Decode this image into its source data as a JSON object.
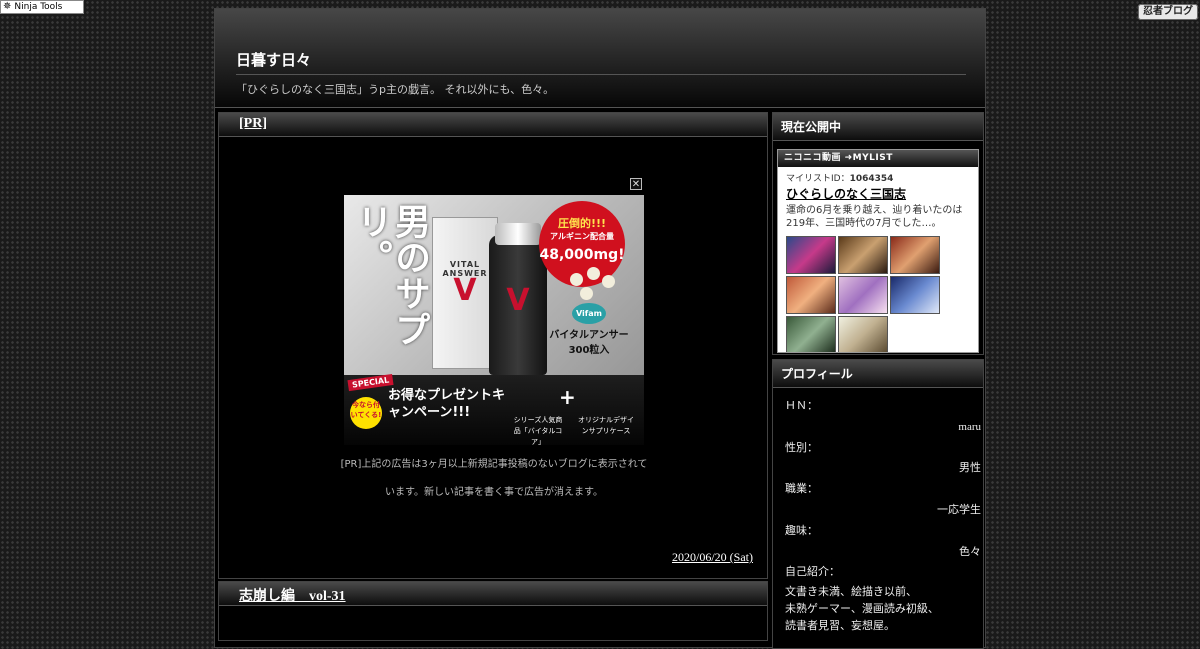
{
  "toolbar": {
    "ninja_tools_label": "Ninja Tools",
    "shinobi_logo": "忍者ブログ"
  },
  "site": {
    "title": "日暮す日々",
    "description": "「ひぐらしのなく三国志」うp主の戯言。 それ以外にも、色々。"
  },
  "posts": [
    {
      "title": "[PR]",
      "ad": {
        "headline": "男のサプリ。",
        "brand": "VITAL ANSWER",
        "badge_line1": "圧倒的!!!",
        "badge_line2": "アルギニン配合量",
        "badge_line3": "48,000mg!",
        "product_logo": "Vifam",
        "product_name": "バイタルアンサー",
        "product_count": "300粒入",
        "special": "SPECIAL",
        "round_badge": "今なら付いてくる!",
        "campaign": "お得なプレゼントキャンペーン!!!",
        "plus": "+",
        "sub1": "シリーズ人気商品「バイタルコア」",
        "sub2": "オリジナルデザインサプリケース",
        "close_symbol": "✕",
        "info_symbol": "i"
      },
      "notice": "[PR]上記の広告は3ヶ月以上新規記事投稿のないブログに表示されています。新しい記事を書く事で広告が消えます。",
      "date": "2020/06/20 (Sat)"
    },
    {
      "title": "志崩し編　vol-31"
    }
  ],
  "sidebar": {
    "now_public": {
      "title": "現在公開中",
      "widget": {
        "bar_label": "ニコニコ動画 ➜MYLIST",
        "mylist_prefix": "マイリストID：",
        "mylist_id": "1064354",
        "name": "ひぐらしのなく三国志",
        "desc": "運命の6月を乗り越え、辿り着いたのは219年、三国時代の7月でした…。"
      }
    },
    "profile": {
      "title": "プロフィール",
      "hn_label": "ＨＮ：",
      "hn_value": "maru",
      "gender_label": "性別：",
      "gender_value": "男性",
      "job_label": "職業：",
      "job_value": "一応学生",
      "hobby_label": "趣味：",
      "hobby_value": "色々",
      "intro_label": "自己紹介：",
      "intro_lines": [
        "文書き未満、絵描き以前、",
        "未熟ゲーマー、漫画読み初級、",
        "読書者見習、妄想屋。"
      ]
    }
  }
}
